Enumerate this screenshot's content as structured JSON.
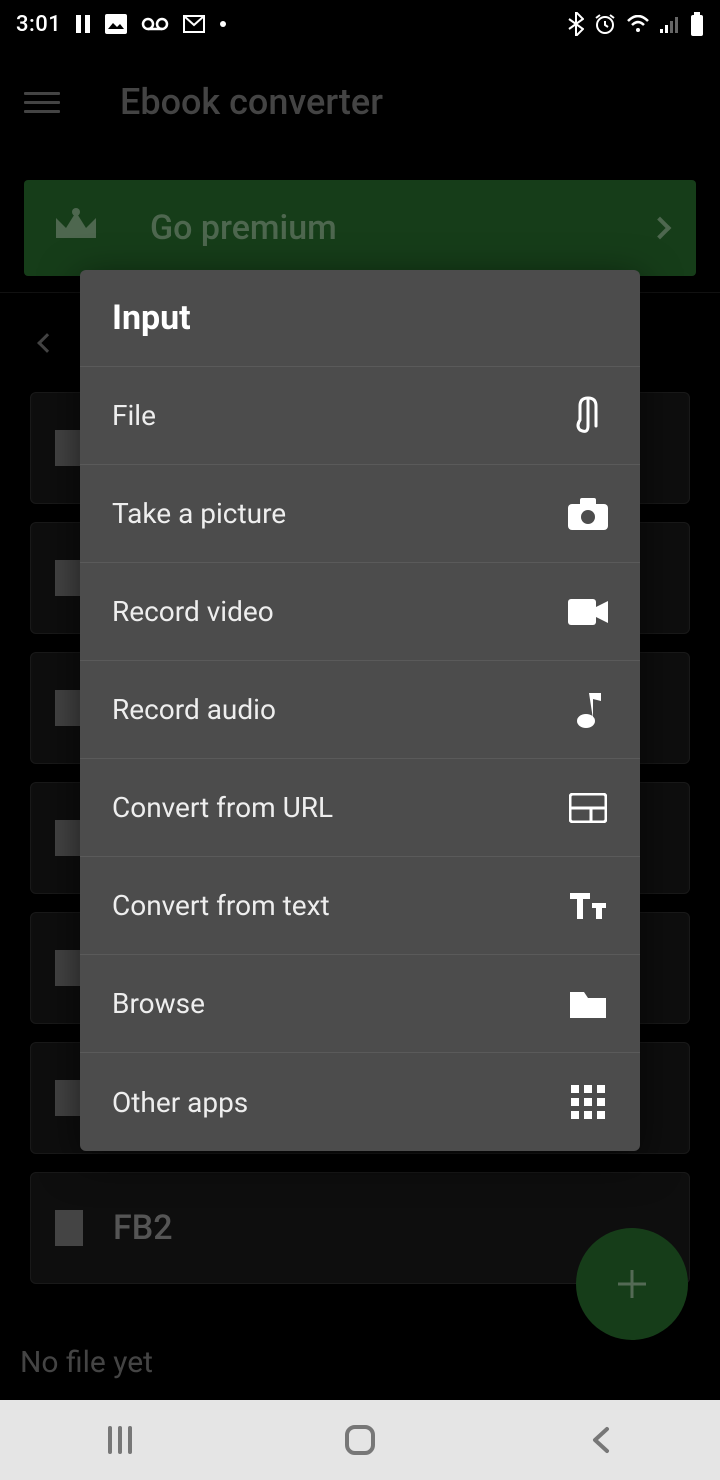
{
  "status": {
    "time": "3:01"
  },
  "toolbar": {
    "title": "Ebook converter"
  },
  "premium": {
    "label": "Go premium"
  },
  "cards": [
    {
      "label": ""
    },
    {
      "label": ""
    },
    {
      "label": ""
    },
    {
      "label": ""
    },
    {
      "label": ""
    },
    {
      "label": ""
    },
    {
      "label": "FB2"
    }
  ],
  "bottom": {
    "label": "No file yet"
  },
  "dialog": {
    "title": "Input",
    "items": [
      {
        "label": "File",
        "icon": "attachment-icon"
      },
      {
        "label": "Take a picture",
        "icon": "camera-icon"
      },
      {
        "label": "Record video",
        "icon": "video-icon"
      },
      {
        "label": "Record audio",
        "icon": "music-note-icon"
      },
      {
        "label": "Convert from URL",
        "icon": "web-icon"
      },
      {
        "label": "Convert from text",
        "icon": "text-format-icon"
      },
      {
        "label": "Browse",
        "icon": "folder-icon"
      },
      {
        "label": "Other apps",
        "icon": "grid-icon"
      }
    ]
  }
}
